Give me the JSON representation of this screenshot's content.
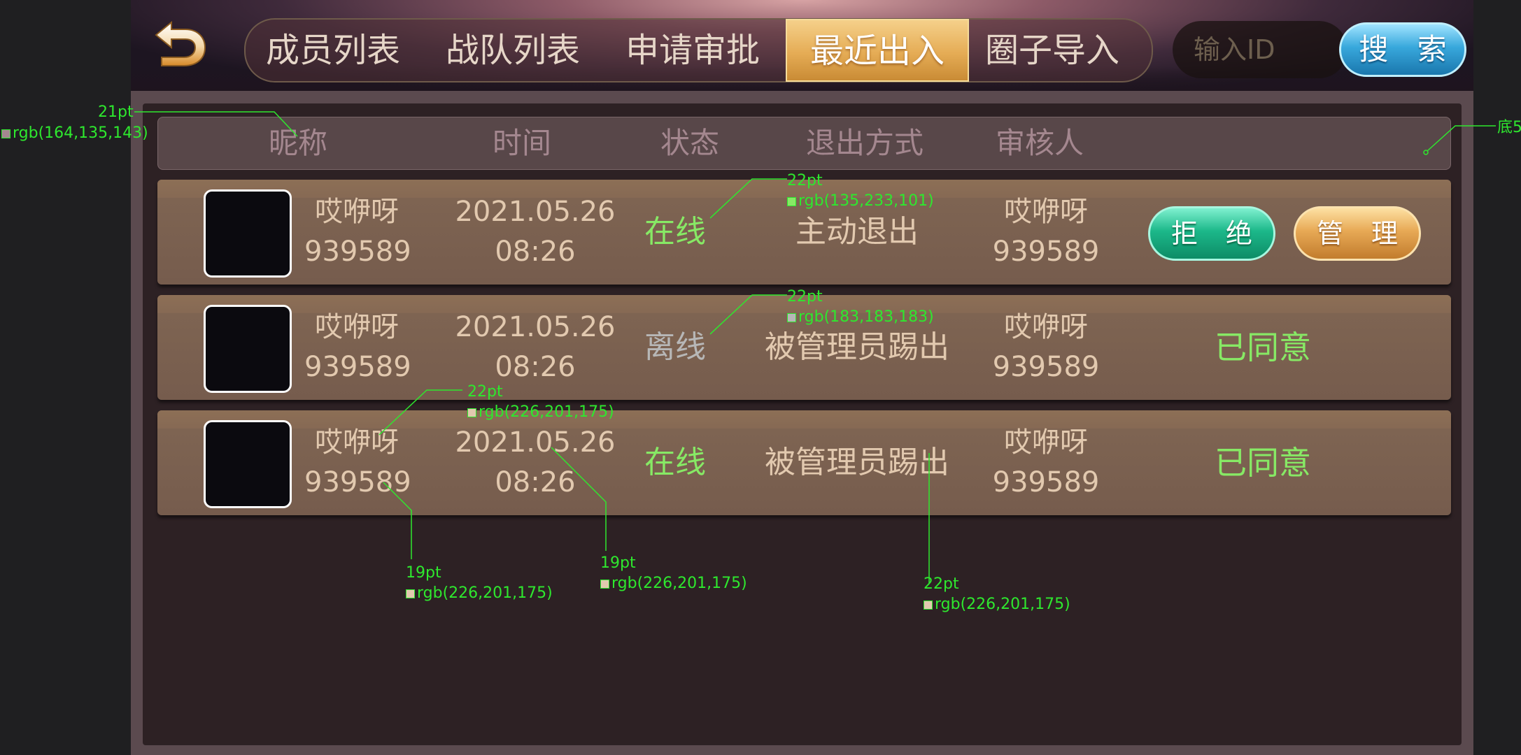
{
  "tabs": [
    {
      "label": "成员列表",
      "active": false
    },
    {
      "label": "战队列表",
      "active": false
    },
    {
      "label": "申请审批",
      "active": false
    },
    {
      "label": "最近出入",
      "active": true
    },
    {
      "label": "圈子导入",
      "active": false
    }
  ],
  "icons": {
    "back": "back-arrow-icon"
  },
  "search": {
    "placeholder": "输入ID",
    "button_label": "搜 索"
  },
  "table": {
    "headers": [
      "昵称",
      "时间",
      "状态",
      "退出方式",
      "审核人"
    ],
    "rows": [
      {
        "nickname": "哎咿呀",
        "id": "939589",
        "date": "2021.05.26",
        "time": "08:26",
        "status": "在线",
        "status_color": "#87e965",
        "exit_method": "主动退出",
        "reviewer_name": "哎咿呀",
        "reviewer_id": "939589",
        "actions": {
          "reject": "拒 绝",
          "manage": "管 理"
        }
      },
      {
        "nickname": "哎咿呀",
        "id": "939589",
        "date": "2021.05.26",
        "time": "08:26",
        "status": "离线",
        "status_color": "#b7b7b7",
        "exit_method": "被管理员踢出",
        "reviewer_name": "哎咿呀",
        "reviewer_id": "939589",
        "result": "已同意"
      },
      {
        "nickname": "哎咿呀",
        "id": "939589",
        "date": "2021.05.26",
        "time": "08:26",
        "status": "在线",
        "status_color": "#87e965",
        "exit_method": "被管理员踢出",
        "reviewer_name": "哎咿呀",
        "reviewer_id": "939589",
        "result": "已同意"
      }
    ]
  },
  "annotations": {
    "header_font": {
      "size": "21pt",
      "color": "rgb(164,135,143)"
    },
    "corner_note": "底5",
    "status_online": {
      "size": "22pt",
      "color": "rgb(135,233,101)"
    },
    "status_offline": {
      "size": "22pt",
      "color": "rgb(183,183,183)"
    },
    "nickname": {
      "size": "22pt",
      "color": "rgb(226,201,175)"
    },
    "id_number": {
      "size": "19pt",
      "color": "rgb(226,201,175)"
    },
    "datetime": {
      "size": "19pt",
      "color": "rgb(226,201,175)"
    },
    "exit_method": {
      "size": "22pt",
      "color": "rgb(226,201,175)"
    }
  }
}
